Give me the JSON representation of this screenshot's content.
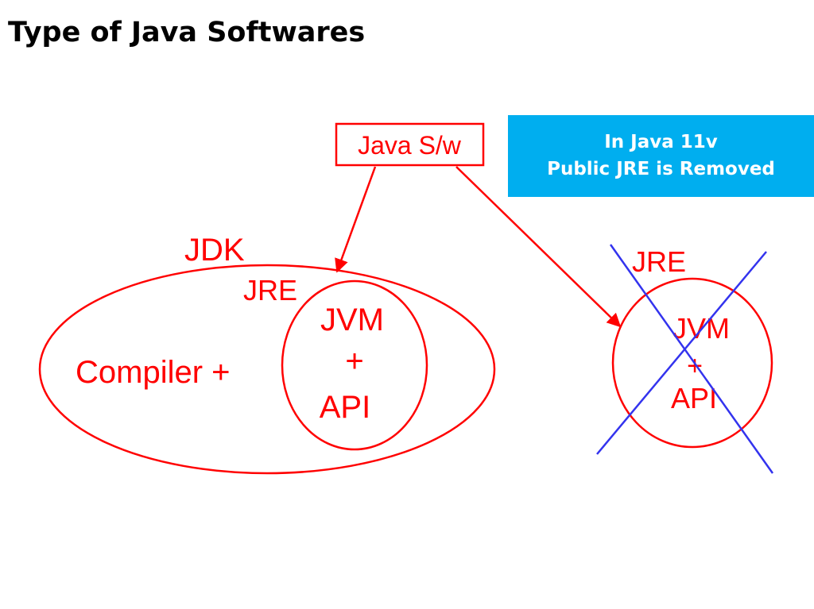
{
  "title": "Type of Java Softwares",
  "note": {
    "line1": "In Java  11v",
    "line2": "Public JRE is Removed"
  },
  "colors": {
    "diagram": "#ff0000",
    "cross": "#3333ee",
    "note_background": "#00aeef",
    "note_text": "#ffffff",
    "title_text": "#000000"
  },
  "diagram": {
    "root_label": "Java S/w",
    "jdk": {
      "label": "JDK",
      "compiler_label": "Compiler  +",
      "jre": {
        "label": "JRE",
        "jvm_label": "JVM",
        "plus_label": "+",
        "api_label": "API"
      }
    },
    "public_jre": {
      "label": "JRE",
      "jvm_label": "JVM",
      "plus_label": "+",
      "api_label": "API",
      "crossed_out": true
    }
  }
}
